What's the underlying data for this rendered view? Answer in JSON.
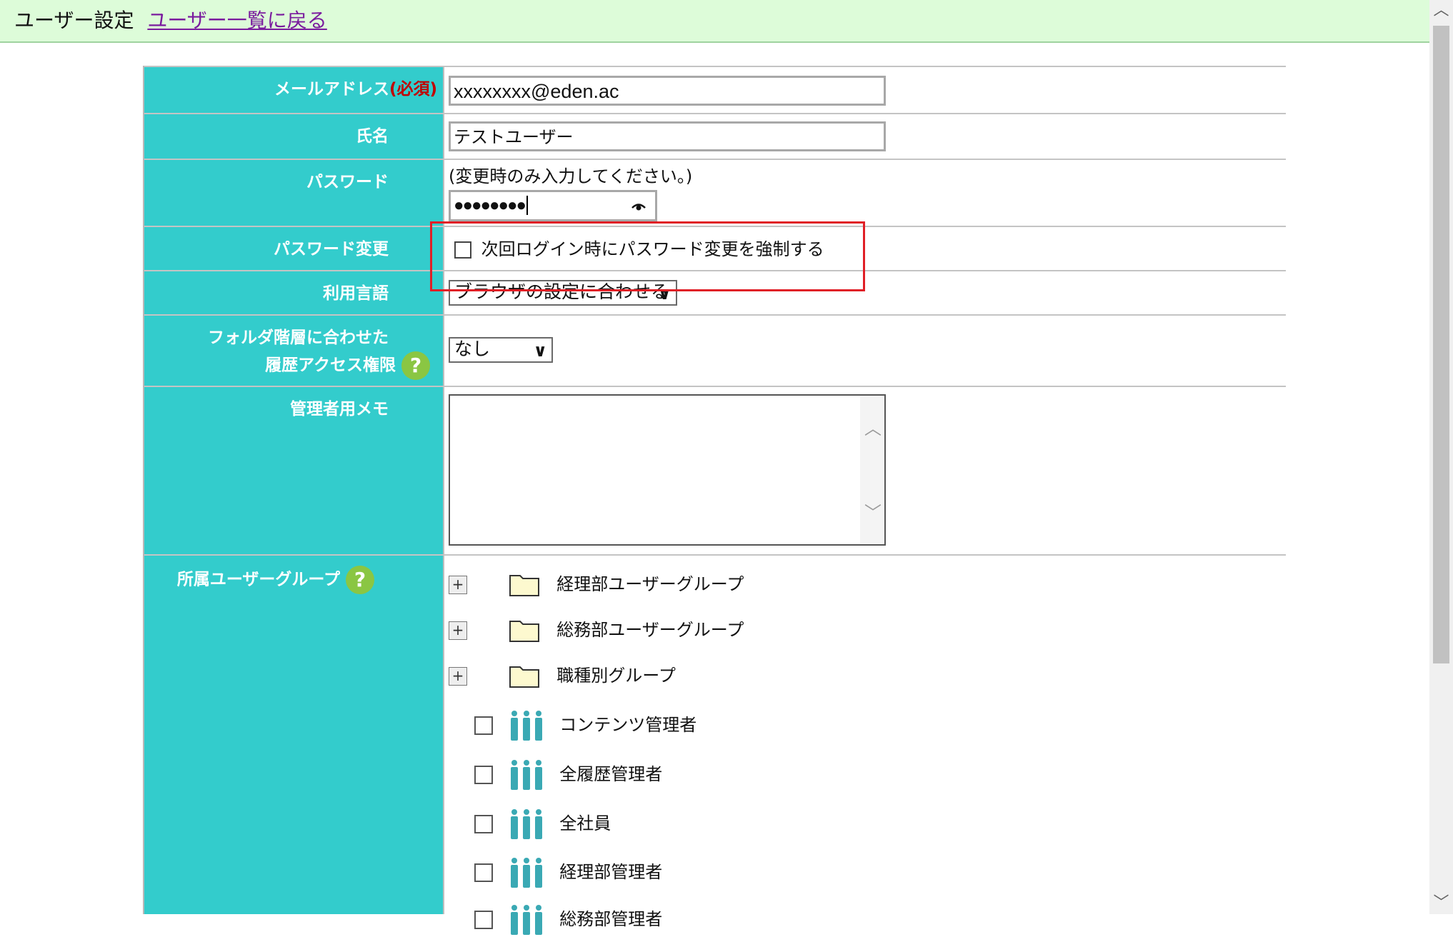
{
  "header": {
    "title": "ユーザー設定",
    "back_link": "ユーザー一覧に戻る"
  },
  "form": {
    "email": {
      "label": "メールアドレス",
      "required": "(必須)",
      "value": "xxxxxxxx@eden.ac"
    },
    "name": {
      "label": "氏名",
      "value": "テストユーザー"
    },
    "password": {
      "label": "パスワード",
      "hint": "(変更時のみ入力してください。)",
      "masked_value": "●●●●●●●●"
    },
    "password_change": {
      "label": "パスワード変更",
      "checkbox_label": "次回ログイン時にパスワード変更を強制する"
    },
    "language": {
      "label": "利用言語",
      "selected": "ブラウザの設定に合わせる"
    },
    "history_access": {
      "label_line1": "フォルダ階層に合わせた",
      "label_line2": "履歴アクセス権限",
      "selected": "なし"
    },
    "admin_memo": {
      "label": "管理者用メモ",
      "value": ""
    },
    "user_groups": {
      "label": "所属ユーザーグループ",
      "folders": [
        "経理部ユーザーグループ",
        "総務部ユーザーグループ",
        "職種別グループ"
      ],
      "groups": [
        "コンテンツ管理者",
        "全履歴管理者",
        "全社員",
        "経理部管理者",
        "総務部管理者"
      ]
    }
  },
  "icons": {
    "help": "question-help-icon",
    "folder": "folder-icon",
    "group": "user-group-icon",
    "eye": "eye-icon"
  },
  "colors": {
    "label_bg": "#33cccc",
    "header_bg": "#ddfcd9",
    "link": "#7a1b9e",
    "required": "#c00000",
    "highlight": "#e01f26",
    "help": "#8ac643"
  }
}
